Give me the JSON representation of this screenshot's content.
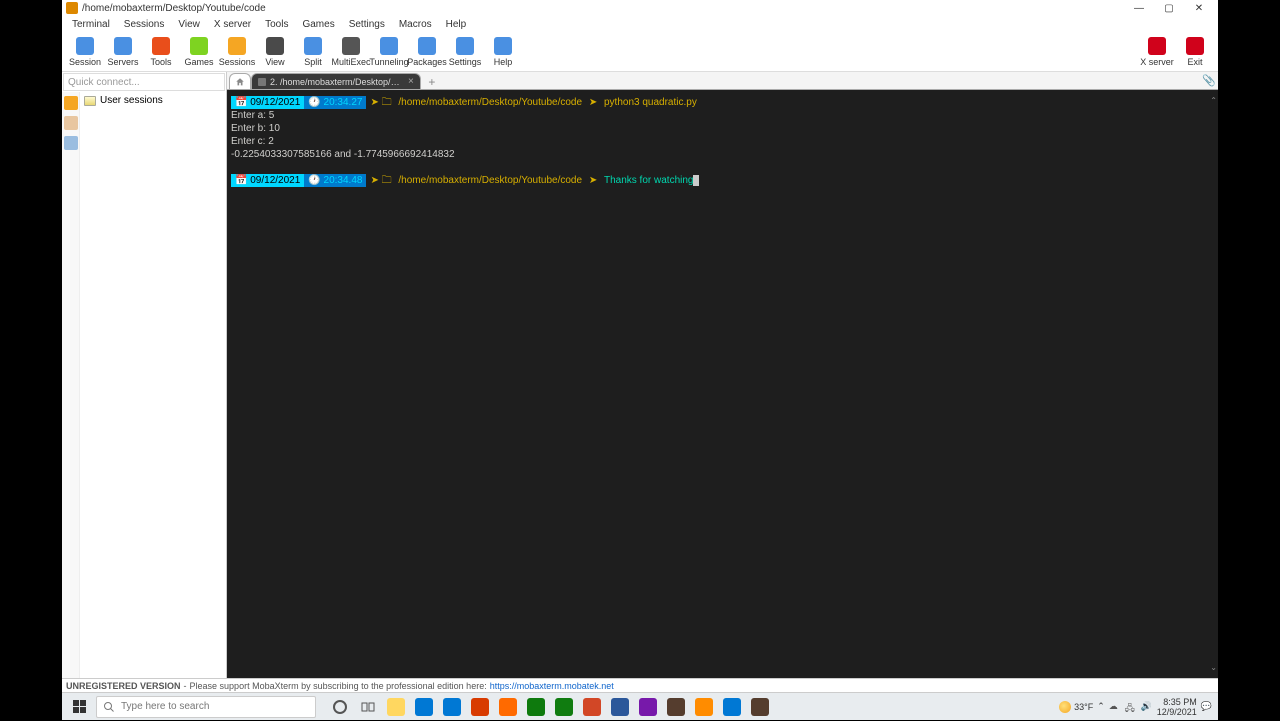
{
  "window": {
    "title": "/home/mobaxterm/Desktop/Youtube/code",
    "controls": {
      "min": "—",
      "max": "▢",
      "close": "✕"
    }
  },
  "menu": [
    "Terminal",
    "Sessions",
    "View",
    "X server",
    "Tools",
    "Games",
    "Settings",
    "Macros",
    "Help"
  ],
  "toolbar": {
    "left": [
      {
        "label": "Session",
        "color": "#4a90e2"
      },
      {
        "label": "Servers",
        "color": "#4a90e2"
      },
      {
        "label": "Tools",
        "color": "#e94e1b"
      },
      {
        "label": "Games",
        "color": "#7ed321"
      },
      {
        "label": "Sessions",
        "color": "#f5a623"
      },
      {
        "label": "View",
        "color": "#4a4a4a"
      },
      {
        "label": "Split",
        "color": "#4a90e2"
      },
      {
        "label": "MultiExec",
        "color": "#555"
      },
      {
        "label": "Tunneling",
        "color": "#4a90e2"
      },
      {
        "label": "Packages",
        "color": "#4a90e2"
      },
      {
        "label": "Settings",
        "color": "#4a90e2"
      },
      {
        "label": "Help",
        "color": "#4a90e2"
      }
    ],
    "right": [
      {
        "label": "X server",
        "color": "#d0021b"
      },
      {
        "label": "Exit",
        "color": "#d0021b"
      }
    ]
  },
  "sidebar": {
    "quick_placeholder": "Quick connect...",
    "node": "User sessions"
  },
  "tabs": {
    "active": "2. /home/mobaxterm/Desktop/Yo…",
    "close": "×",
    "plus": "+"
  },
  "terminal": {
    "prompt1": {
      "date": "09/12/2021",
      "time": "20:34.27",
      "path": "/home/mobaxterm/Desktop/Youtube/code",
      "cmd": "python3 quadratic.py"
    },
    "output": [
      "Enter a: 5",
      "Enter b: 10",
      "Enter c: 2",
      "-0.2254033307585166 and -1.7745966692414832"
    ],
    "prompt2": {
      "date": "09/12/2021",
      "time": "20:34.48",
      "path": "/home/mobaxterm/Desktop/Youtube/code",
      "cmd": "Thanks for watching"
    }
  },
  "status": {
    "version": "UNREGISTERED VERSION",
    "dash": " - ",
    "text": "Please support MobaXterm by subscribing to the professional edition here: ",
    "link": "https://mobaxterm.mobatek.net"
  },
  "taskbar": {
    "search_placeholder": "Type here to search",
    "apps": [
      {
        "color": "#ffd760"
      },
      {
        "color": "#0078d4"
      },
      {
        "color": "#0078d4"
      },
      {
        "color": "#d83b01"
      },
      {
        "color": "#ff6a00"
      },
      {
        "color": "#0e7a0d"
      },
      {
        "color": "#107c10"
      },
      {
        "color": "#d24726"
      },
      {
        "color": "#2b579a"
      },
      {
        "color": "#7719aa"
      },
      {
        "color": "#553d2e"
      },
      {
        "color": "#ff8c00"
      },
      {
        "color": "#0078d4"
      },
      {
        "color": "#553d2e"
      }
    ],
    "weather_temp": "33°F",
    "time": "8:35 PM",
    "date": "12/9/2021"
  }
}
